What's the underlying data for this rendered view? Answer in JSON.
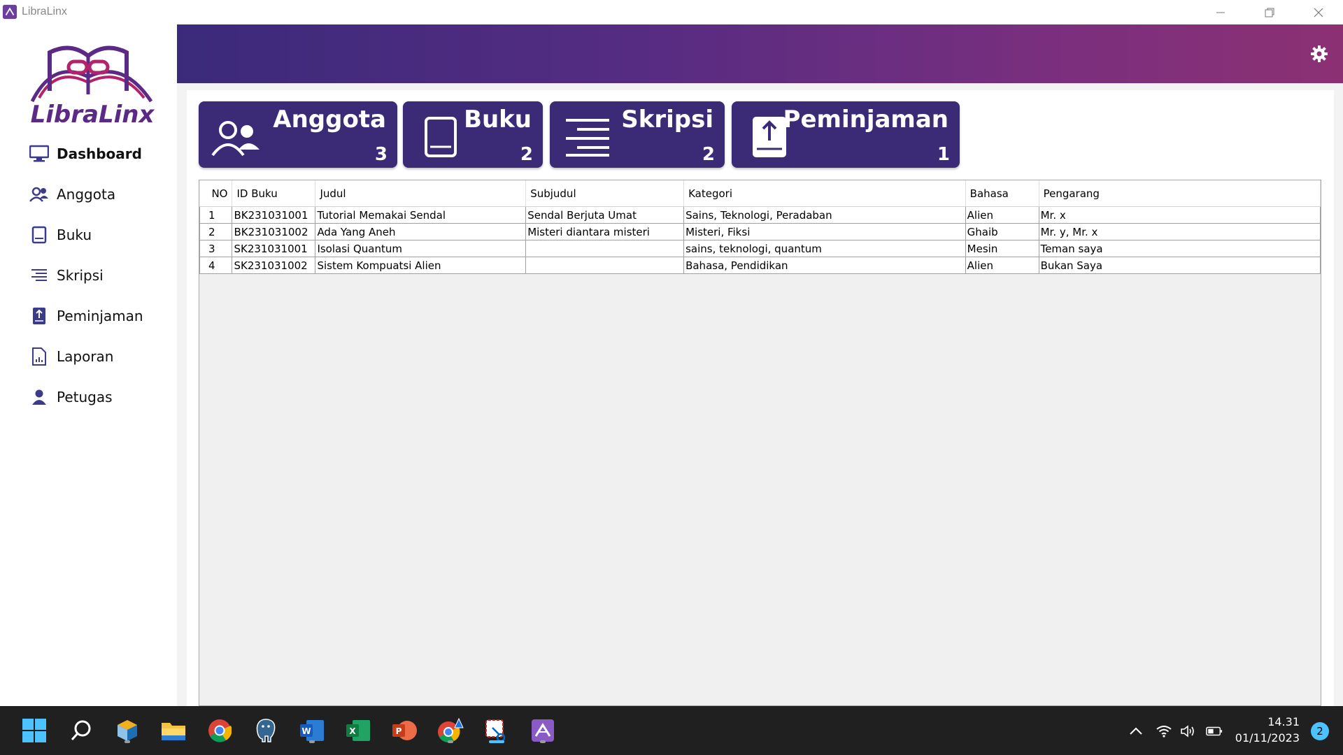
{
  "window": {
    "title": "LibraLinx"
  },
  "logo": {
    "text": "LibraLinx"
  },
  "sidebar": {
    "items": [
      {
        "label": "Dashboard",
        "icon": "monitor-icon",
        "active": true
      },
      {
        "label": "Anggota",
        "icon": "users-icon"
      },
      {
        "label": "Buku",
        "icon": "book-icon"
      },
      {
        "label": "Skripsi",
        "icon": "lines-icon"
      },
      {
        "label": "Peminjaman",
        "icon": "upload-book-icon"
      },
      {
        "label": "Laporan",
        "icon": "report-icon"
      },
      {
        "label": "Petugas",
        "icon": "person-icon"
      }
    ]
  },
  "header": {
    "settings_icon": "gear-icon"
  },
  "cards": [
    {
      "title": "Anggota",
      "count": "3",
      "icon": "users-icon"
    },
    {
      "title": "Buku",
      "count": "2",
      "icon": "book-icon"
    },
    {
      "title": "Skripsi",
      "count": "2",
      "icon": "lines-icon"
    },
    {
      "title": "Peminjaman",
      "count": "1",
      "icon": "upload-book-icon"
    }
  ],
  "table": {
    "columns": [
      "NO",
      "ID Buku",
      "Judul",
      "Subjudul",
      "Kategori",
      "Bahasa",
      "Pengarang"
    ],
    "rows": [
      [
        "1",
        "BK231031001",
        "Tutorial Memakai Sendal",
        "Sendal Berjuta Umat",
        "Sains, Teknologi, Peradaban",
        "Alien",
        "Mr. x"
      ],
      [
        "2",
        "BK231031002",
        "Ada Yang Aneh",
        "Misteri diantara misteri",
        "Misteri, Fiksi",
        "Ghaib",
        "Mr. y, Mr. x"
      ],
      [
        "3",
        "SK231031001",
        "Isolasi Quantum",
        "",
        "sains, teknologi, quantum",
        "Mesin",
        "Teman saya"
      ],
      [
        "4",
        "SK231031002",
        "Sistem Kompuatsi Alien",
        "",
        "Bahasa, Pendidikan",
        "Alien",
        "Bukan Saya"
      ]
    ]
  },
  "taskbar": {
    "apps": [
      "start-icon",
      "search-icon",
      "virtualbox-icon",
      "file-explorer-icon",
      "chrome-icon",
      "postgres-icon",
      "word-icon",
      "excel-icon",
      "powerpoint-icon",
      "chrome-dev-icon",
      "snipping-tool-icon",
      "libralinx-icon"
    ],
    "time": "14.31",
    "date": "01/11/2023",
    "notifications": "2"
  },
  "colors": {
    "card": "#3b2a75",
    "header_start": "#3b2a7a",
    "header_end": "#8c3073",
    "accent": "#4cc2ff"
  }
}
